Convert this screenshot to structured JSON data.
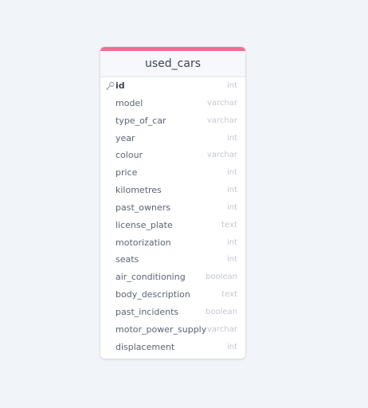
{
  "table": {
    "name": "used_cars",
    "accent_color": "#f06e92",
    "primary_key_icon": "key-icon",
    "columns": [
      {
        "name": "id",
        "type": "int",
        "primary_key": true
      },
      {
        "name": "model",
        "type": "varchar"
      },
      {
        "name": "type_of_car",
        "type": "varchar"
      },
      {
        "name": "year",
        "type": "int"
      },
      {
        "name": "colour",
        "type": "varchar"
      },
      {
        "name": "price",
        "type": "int"
      },
      {
        "name": "kilometres",
        "type": "int"
      },
      {
        "name": "past_owners",
        "type": "int"
      },
      {
        "name": "license_plate",
        "type": "text"
      },
      {
        "name": "motorization",
        "type": "int"
      },
      {
        "name": "seats",
        "type": "int"
      },
      {
        "name": "air_conditioning",
        "type": "boolean"
      },
      {
        "name": "body_description",
        "type": "text"
      },
      {
        "name": "past_incidents",
        "type": "boolean"
      },
      {
        "name": "motor_power_supply",
        "type": "varchar"
      },
      {
        "name": "displacement",
        "type": "int"
      }
    ]
  }
}
